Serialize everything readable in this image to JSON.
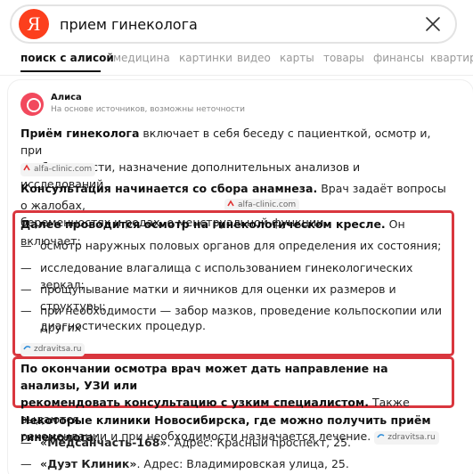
{
  "search": {
    "logo_letter": "Я",
    "query": "прием гинеколога"
  },
  "tabs": [
    {
      "label": "поиск с алисой",
      "active": true
    },
    {
      "label": "медицина"
    },
    {
      "label": "картинки"
    },
    {
      "label": "видео"
    },
    {
      "label": "карты"
    },
    {
      "label": "товары"
    },
    {
      "label": "финансы"
    },
    {
      "label": "квартиры"
    }
  ],
  "alice": {
    "name": "Алиса",
    "subtitle": "На основе источников, возможны неточности"
  },
  "answer": {
    "p1_bold": "Приём гинеколога",
    "p1_text_a": " включает в себя беседу с пациенткой, осмотр и, при",
    "p1_text_b": "необходимости, назначение дополнительных анализов и исследований.",
    "p1_source": "alfa-clinic.com",
    "p2_bold": "Консультация начинается со сбора анамнеза.",
    "p2_text_a": " Врач задаёт вопросы о жалобах,",
    "p2_text_b": "беременностях и родах, о менструальной функции.",
    "p2_source": "alfa-clinic.com",
    "p3_bold": "Далее проводится осмотр на гинекологическом кресле.",
    "p3_text": " Он включает:",
    "p3_items": [
      "осмотр наружных половых органов для определения их состояния;",
      "исследование влагалища с использованием гинекологических зеркал;",
      "прощупывание матки и яичников для оценки их размеров и структуры;",
      "при необходимости — забор мазков, проведение кольпоскопии или других"
    ],
    "p3_item4_cont": "диагностических процедур.",
    "p3_source": "zdravitsa.ru",
    "p4_bold_a": "По окончании осмотра врач может дать направление на анализы, УЗИ или",
    "p4_bold_b": "рекомендовать консультацию с узким специалистом.",
    "p4_text_a": " Также выдаются",
    "p4_text_b": "рекомендации и при необходимости назначается лечение.",
    "p4_source": "zdravitsa.ru",
    "p5_bold": "Некоторые клиники Новосибирска, где можно получить приём гинеколога",
    "p5_colon": ":",
    "clinics": [
      {
        "name": "«Медсанчасть-168»",
        "address": ". Адрес: Красный проспект, 25."
      },
      {
        "name": "«Дуэт Клиник»",
        "address": ". Адрес: Владимировская улица, 25."
      }
    ]
  },
  "colors": {
    "brand_red": "#fc3f1d",
    "alice_pink": "#f2495d",
    "highlight_border": "#d9363e"
  },
  "icons": {
    "clear": "close-icon",
    "alfa_source": "alfa-clinic-favicon-icon",
    "zdravitsa_source": "zdravitsa-favicon-icon"
  }
}
